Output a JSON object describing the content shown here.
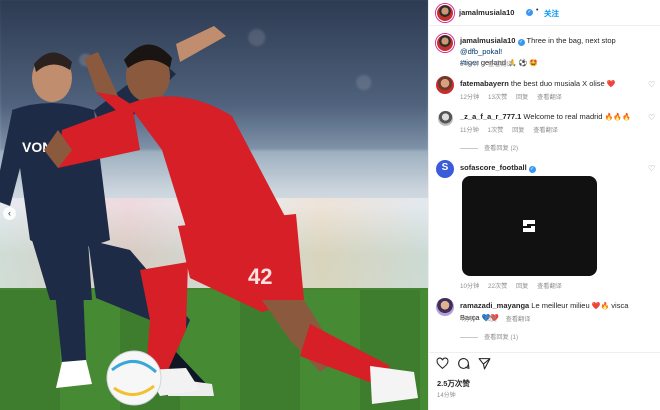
{
  "post_header": {
    "username": "jamalmusiala10",
    "follow_label": "关注",
    "more": "···"
  },
  "caption": {
    "username": "jamalmusiala10",
    "text": "Three in the bag, next stop",
    "mention": "@dfb_pokal!",
    "hashtag": "#tiger",
    "text2": "gerland",
    "emojis": "🙏 ⚽ 🤩",
    "time": "14分钟",
    "translate": "查看翻译"
  },
  "comments": [
    {
      "username": "fatemabayern",
      "text": "the best duo musiala X olise",
      "emoji": "❤️",
      "time": "12分钟",
      "likes": "13次赞",
      "reply": "回复",
      "translate": "查看翻译"
    },
    {
      "username": "_z_a_f_a_r_777.1",
      "text": "Welcome to real madrid",
      "emoji": "🔥🔥🔥",
      "time": "11分钟",
      "likes": "1次赞",
      "reply": "回复",
      "translate": "查看翻译",
      "view_replies": "查看回复 (2)"
    },
    {
      "username": "sofascore_football",
      "time": "10分钟",
      "likes": "22次赞",
      "reply": "回复",
      "translate": "查看翻译"
    },
    {
      "username": "ramazadi_mayanga",
      "text": "Le meilleur milieu",
      "emoji": "❤️🔥",
      "text2": "visca Barça",
      "emoji2": "💙❤️",
      "time": "4分钟",
      "reply": "回复",
      "translate": "查看翻译",
      "view_replies": "查看回复 (1)"
    }
  ],
  "actions": {
    "like_icon": "heart-outline-icon",
    "comment_icon": "comment-icon",
    "share_icon": "share-icon",
    "likes": "2.5万次赞",
    "time": "14分钟"
  },
  "colors": {
    "accent": "#0095f6",
    "verified": "#3897f0",
    "muted": "#8e8e8e",
    "kit_red": "#d61f26",
    "kit_navy": "#1e2b47"
  },
  "photo_alt_names": [
    "player-red-kit",
    "player-navy-kit",
    "football"
  ]
}
